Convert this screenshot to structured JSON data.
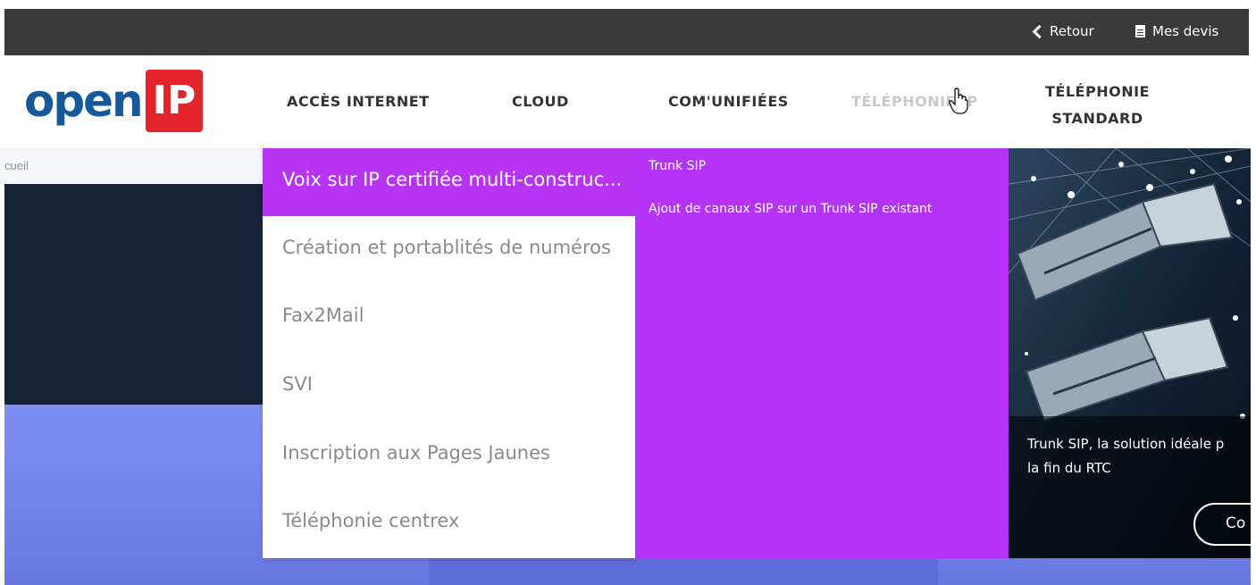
{
  "topbar": {
    "back_label": "Retour",
    "quotes_label": "Mes devis"
  },
  "logo": {
    "part1": "open",
    "part2": "IP"
  },
  "nav": {
    "items": [
      {
        "label": "ACCÈS INTERNET"
      },
      {
        "label": "CLOUD"
      },
      {
        "label": "COM'UNIFIÉES"
      },
      {
        "label": "TÉLÉPHONIE IP"
      },
      {
        "label_line1": "TÉLÉPHONIE",
        "label_line2": "STANDARD"
      }
    ]
  },
  "breadcrumb": {
    "text": "cueil"
  },
  "menu": {
    "items": [
      {
        "label": "Voix sur IP certifiée multi-construc..."
      },
      {
        "label": "Création et portablités de numéros"
      },
      {
        "label": "Fax2Mail"
      },
      {
        "label": "SVI"
      },
      {
        "label": "Inscription aux Pages Jaunes"
      },
      {
        "label": "Téléphonie centrex"
      }
    ],
    "subitems": [
      {
        "label": "Trunk SIP"
      },
      {
        "label": "Ajout de canaux SIP sur un Trunk SIP existant"
      }
    ]
  },
  "promo": {
    "caption_line1": "Trunk SIP, la solution idéale p",
    "caption_line2": "la fin du RTC",
    "button_label": "Co"
  },
  "colors": {
    "topbar": "#3a3a3a",
    "accent_purple": "#b433f7",
    "logo_blue": "#16599a",
    "logo_red": "#e3242b"
  }
}
